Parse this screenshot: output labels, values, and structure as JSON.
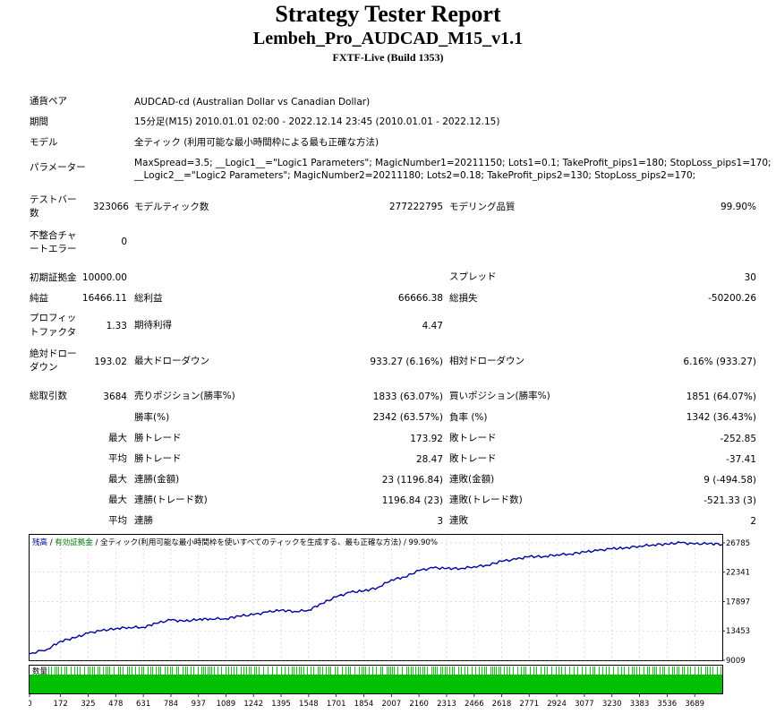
{
  "header": {
    "title": "Strategy Tester Report",
    "subtitle": "Lembeh_Pro_AUDCAD_M15_v1.1",
    "build": "FXTF-Live (Build 1353)"
  },
  "settings": {
    "pair_label": "通貨ペア",
    "pair_value": "AUDCAD-cd (Australian Dollar vs Canadian Dollar)",
    "period_label": "期間",
    "period_value": "15分足(M15) 2010.01.01 02:00 - 2022.12.14 23:45 (2010.01.01 - 2022.12.15)",
    "model_label": "モデル",
    "model_value": "全ティック (利用可能な最小時間枠による最も正確な方法)",
    "params_label": "パラメーター",
    "params_line1": "MaxSpread=3.5; __Logic1__=\"Logic1 Parameters\"; MagicNumber1=20211150; Lots1=0.1; TakeProfit_pips1=180; StopLoss_pips1=170;",
    "params_line2": "__Logic2__=\"Logic2 Parameters\"; MagicNumber2=20211180; Lots2=0.18; TakeProfit_pips2=130; StopLoss_pips2=170;"
  },
  "stats": {
    "bars_label_1": "テストバー",
    "bars_label_2": "数",
    "bars_value": "323066",
    "ticks_label": "モデルティック数",
    "ticks_value": "277222795",
    "quality_label": "モデリング品質",
    "quality_value": "99.90%",
    "mismatch_label_1": "不整合チャ",
    "mismatch_label_2": "ートエラー",
    "mismatch_value": "0",
    "deposit_label": "初期証拠金",
    "deposit_value": "10000.00",
    "spread_label": "スプレッド",
    "spread_value": "30",
    "net_label": "純益",
    "net_value": "16466.11",
    "gross_profit_label": "総利益",
    "gross_profit_value": "66666.38",
    "gross_loss_label": "総損失",
    "gross_loss_value": "-50200.26",
    "pf_label_1": "プロフィッ",
    "pf_label_2": "トファクタ",
    "pf_value": "1.33",
    "expected_label": "期待利得",
    "expected_value": "4.47",
    "abs_dd_label_1": "絶対ドロー",
    "abs_dd_label_2": "ダウン",
    "abs_dd_value": "193.02",
    "max_dd_label": "最大ドローダウン",
    "max_dd_value": "933.27 (6.16%)",
    "rel_dd_label": "相対ドローダウン",
    "rel_dd_value": "6.16% (933.27)",
    "total_trades_label": "総取引数",
    "total_trades_value": "3684",
    "short_label": "売りポジション(勝率%)",
    "short_value": "1833 (63.07%)",
    "long_label": "買いポジション(勝率%)",
    "long_value": "1851 (64.07%)",
    "win_rate_label": "勝率(%)",
    "win_rate_value": "2342 (63.57%)",
    "loss_rate_label": "負率 (%)",
    "loss_rate_value": "1342 (36.43%)",
    "max_label": "最大",
    "avg_label": "平均",
    "largest_win_label": "勝トレード",
    "largest_win_value": "173.92",
    "largest_loss_label": "敗トレード",
    "largest_loss_value": "-252.85",
    "avg_win_label": "勝トレード",
    "avg_win_value": "28.47",
    "avg_loss_label": "敗トレード",
    "avg_loss_value": "-37.41",
    "cons_wins_label": "連勝(金額)",
    "cons_wins_value": "23 (1196.84)",
    "cons_losses_label": "連敗(金額)",
    "cons_losses_value": "9 (-494.58)",
    "cons_profit_label": "連勝(トレード数)",
    "cons_profit_value": "1196.84 (23)",
    "cons_loss_label": "連敗(トレード数)",
    "cons_loss_value": "-521.33 (3)",
    "avg_cons_wins_label": "連勝",
    "avg_cons_wins_value": "3",
    "avg_cons_losses_label": "連敗",
    "avg_cons_losses_value": "2"
  },
  "chart_data": {
    "type": "line",
    "legend_balance": "残高",
    "legend_sep1": " / ",
    "legend_equity": "有効証拠金",
    "legend_sep2": " / ",
    "legend_rest": "全ティック(利用可能な最小時間枠を使いすべてのティックを生成する、最も正確な方法) / 99.90%",
    "volume_label": "数量",
    "balance_color": "#0000a0",
    "equity_color": "#008000",
    "volume_color": "#00c000",
    "ylim": [
      9009,
      28000
    ],
    "xlim": [
      0,
      3842
    ],
    "y_ticks": [
      "26785",
      "22341",
      "17897",
      "13453",
      "9009"
    ],
    "y_tick_values": [
      26785,
      22341,
      17897,
      13453,
      9009
    ],
    "x_ticks": [
      "0",
      "172",
      "325",
      "478",
      "631",
      "784",
      "937",
      "1089",
      "1242",
      "1395",
      "1548",
      "1701",
      "1854",
      "2007",
      "2160",
      "2313",
      "2466",
      "2618",
      "2771",
      "2924",
      "3077",
      "3230",
      "3383",
      "3536",
      "3689"
    ],
    "x_tick_values": [
      0,
      172,
      325,
      478,
      631,
      784,
      937,
      1089,
      1242,
      1395,
      1548,
      1701,
      1854,
      2007,
      2160,
      2313,
      2466,
      2618,
      2771,
      2924,
      3077,
      3230,
      3383,
      3536,
      3689
    ],
    "balance": {
      "x": [
        0,
        100,
        172,
        250,
        325,
        400,
        478,
        550,
        631,
        700,
        784,
        860,
        937,
        1000,
        1089,
        1160,
        1242,
        1320,
        1395,
        1470,
        1548,
        1620,
        1701,
        1780,
        1854,
        1930,
        2007,
        2080,
        2160,
        2240,
        2313,
        2390,
        2466,
        2540,
        2618,
        2700,
        2771,
        2850,
        2924,
        3000,
        3077,
        3150,
        3230,
        3300,
        3383,
        3460,
        3536,
        3610,
        3689,
        3770,
        3842
      ],
      "y": [
        10000,
        10700,
        11900,
        12400,
        13100,
        13500,
        13800,
        14000,
        14000,
        14600,
        15100,
        14900,
        15200,
        15300,
        15300,
        15700,
        15900,
        16300,
        16600,
        16400,
        16600,
        17600,
        18600,
        19300,
        19500,
        20000,
        21200,
        21600,
        22600,
        23000,
        22900,
        22900,
        23200,
        23400,
        24000,
        24300,
        24700,
        24700,
        25000,
        25100,
        25400,
        25600,
        25900,
        26000,
        26300,
        26500,
        26600,
        26800,
        26600,
        26700,
        26550
      ]
    }
  }
}
